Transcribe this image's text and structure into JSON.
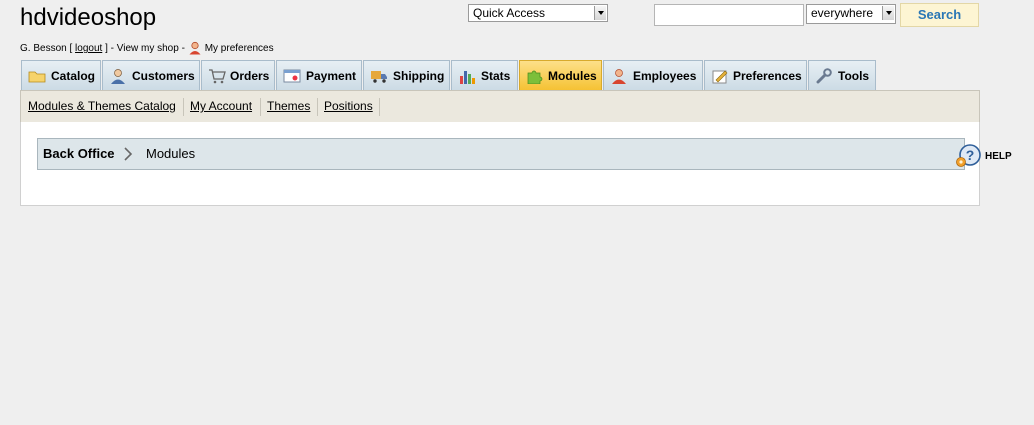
{
  "header": {
    "shop_name": "hdvideoshop",
    "user_prefix": "G. Besson [",
    "logout": "logout",
    "user_suffix": "] - View my shop -",
    "preferences": "My preferences"
  },
  "quick_access": {
    "selected": "Quick Access"
  },
  "search": {
    "value": "",
    "scope": "everywhere",
    "button": "Search"
  },
  "tabs": [
    {
      "label": "Catalog",
      "icon": "folder-icon"
    },
    {
      "label": "Customers",
      "icon": "customer-icon"
    },
    {
      "label": "Orders",
      "icon": "cart-icon"
    },
    {
      "label": "Payment",
      "icon": "payment-icon"
    },
    {
      "label": "Shipping",
      "icon": "truck-icon"
    },
    {
      "label": "Stats",
      "icon": "bar-chart-icon"
    },
    {
      "label": "Modules",
      "icon": "puzzle-icon",
      "active": true
    },
    {
      "label": "Employees",
      "icon": "employee-icon"
    },
    {
      "label": "Preferences",
      "icon": "preferences-icon"
    },
    {
      "label": "Tools",
      "icon": "wrench-icon"
    }
  ],
  "subnav": [
    {
      "label": "Modules & Themes Catalog"
    },
    {
      "label": "My Account"
    },
    {
      "label": "Themes"
    },
    {
      "label": "Positions"
    }
  ],
  "breadcrumb": {
    "root": "Back Office",
    "current": "Modules"
  },
  "help": {
    "label": "HELP"
  },
  "colors": {
    "active_tab": "#f5c234",
    "search_button_text": "#2a77b5",
    "breadcrumb_bg": "#dde6ea",
    "subnav_bg": "#ebe8de"
  }
}
